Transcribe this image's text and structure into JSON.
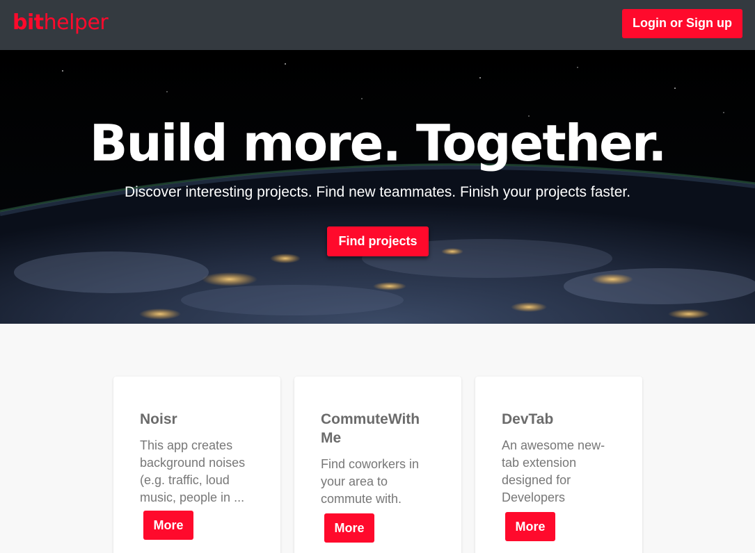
{
  "navbar": {
    "brand_bold": "bit",
    "brand_light": "helper",
    "login_label": "Login or Sign up"
  },
  "hero": {
    "title": "Build more. Together.",
    "subtitle": "Discover interesting projects. Find new teammates. Finish your projects faster.",
    "cta_label": "Find projects"
  },
  "projects": [
    {
      "title": "Noisr",
      "description": "This app creates background noises (e.g. traffic, loud music, people in ...",
      "more_label": "More"
    },
    {
      "title": "CommuteWith Me",
      "description": "Find coworkers in your area to commute with.",
      "more_label": "More"
    },
    {
      "title": "DevTab",
      "description": "An awesome new-tab extension designed for Developers",
      "more_label": "More"
    }
  ],
  "colors": {
    "accent": "#ff0a2c",
    "navbar_bg": "#343a40",
    "page_bg": "#f8f8f8"
  }
}
